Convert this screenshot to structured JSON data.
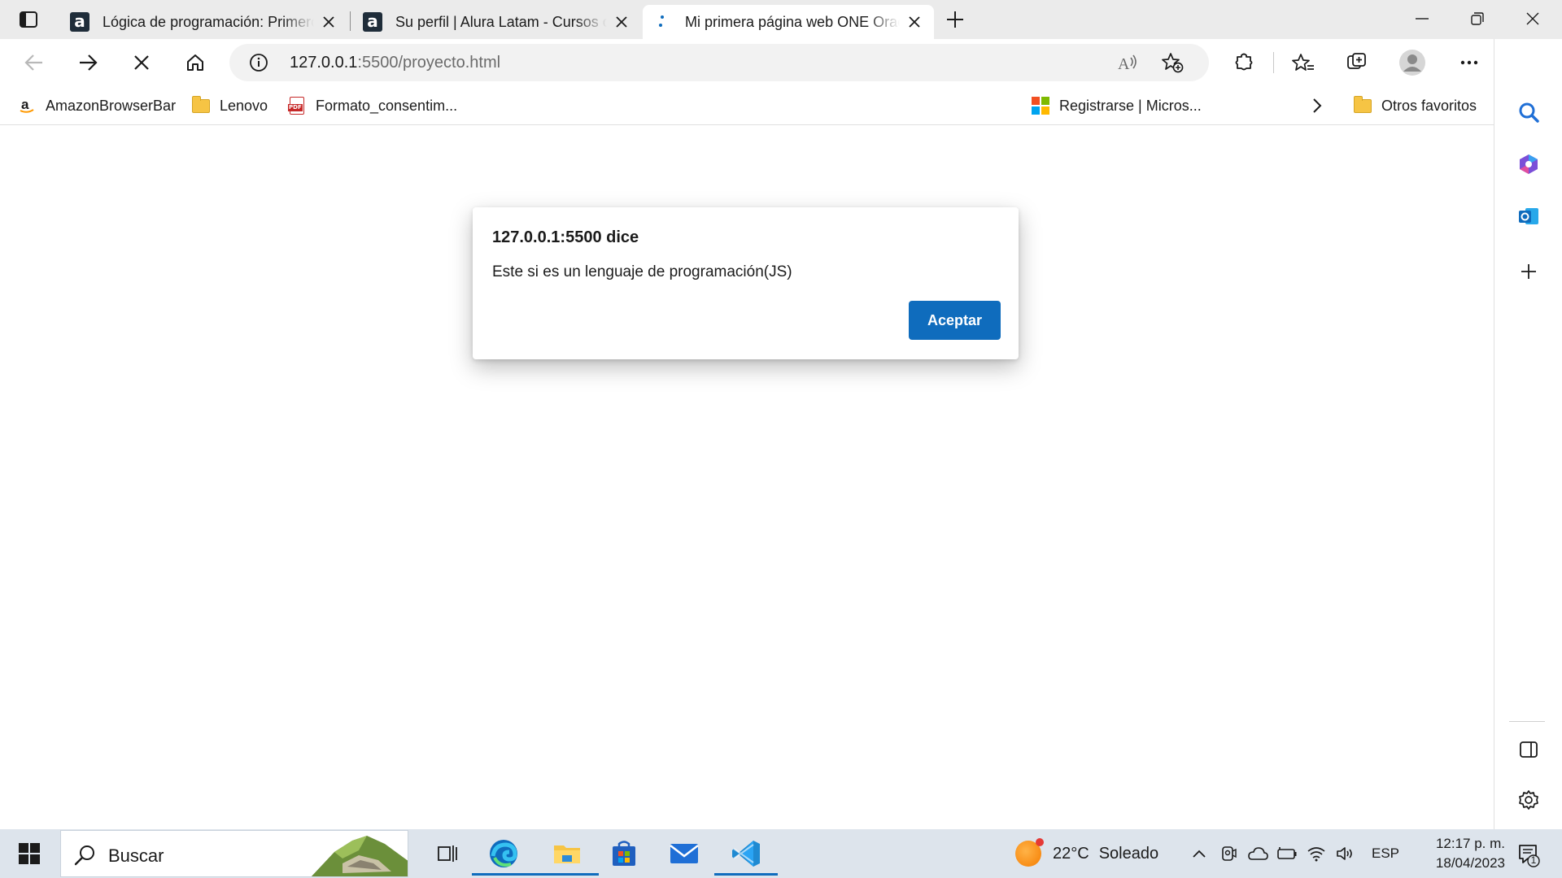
{
  "browser": {
    "tabs": [
      {
        "title": "Lógica de programación: Primeros pasos",
        "favicon": "alura-icon",
        "active": false
      },
      {
        "title": "Su perfil | Alura Latam - Cursos online",
        "favicon": "alura-icon",
        "active": false
      },
      {
        "title": "Mi primera página web ONE Oracle",
        "favicon": "loading-icon",
        "active": true
      }
    ],
    "address": {
      "host": "127.0.0.1",
      "path": ":5500/proyecto.html"
    },
    "favorites": [
      {
        "label": "AmazonBrowserBar",
        "icon": "amazon-icon"
      },
      {
        "label": "Lenovo",
        "icon": "folder-icon"
      },
      {
        "label": "Formato_consentim...",
        "icon": "pdf-icon"
      },
      {
        "label": "Registrarse | Micros...",
        "icon": "microsoft-icon"
      },
      {
        "label": "Otros favoritos",
        "icon": "folder-icon"
      }
    ]
  },
  "dialog": {
    "title": "127.0.0.1:5500 dice",
    "message": "Este si es un lenguaje de programación(JS)",
    "ok_label": "Aceptar"
  },
  "taskbar": {
    "search_placeholder": "Buscar",
    "weather": {
      "temp": "22°C",
      "condition": "Soleado"
    },
    "language": "ESP",
    "time": "12:17 p. m.",
    "date": "18/04/2023",
    "notification_count": "1"
  },
  "colors": {
    "accent": "#0f6cbd",
    "tabstrip": "#ebebeb",
    "taskbar": "#dde4ec"
  }
}
